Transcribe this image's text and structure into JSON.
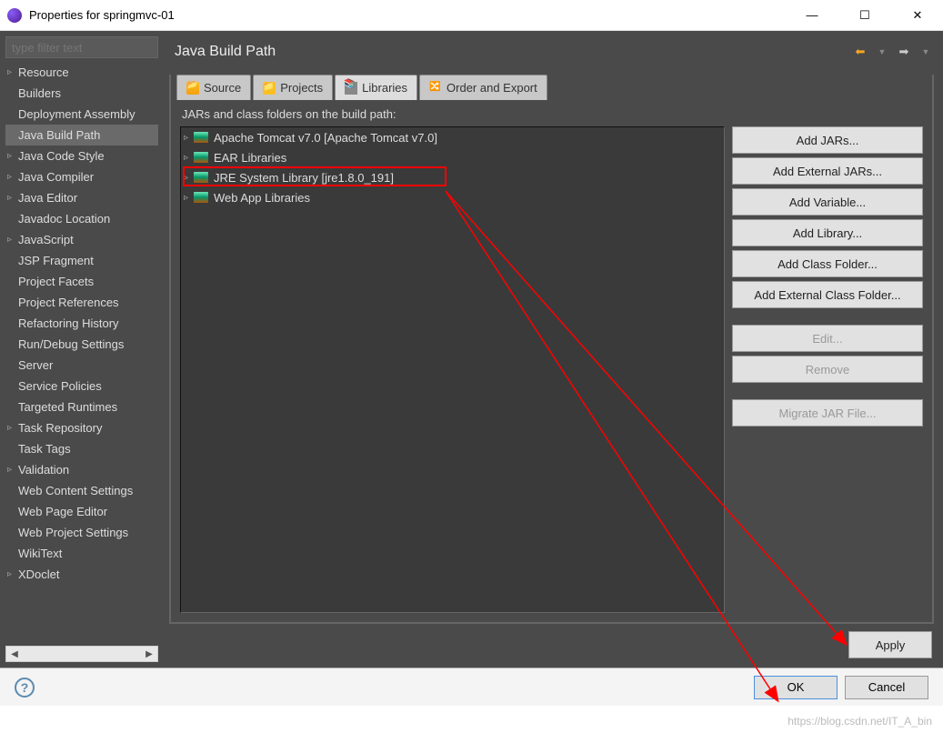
{
  "window": {
    "title": "Properties for springmvc-01",
    "minimize": "—",
    "maximize": "☐",
    "close": "✕"
  },
  "sidebar": {
    "filter_placeholder": "type filter text",
    "items": [
      {
        "label": "Resource",
        "expandable": true
      },
      {
        "label": "Builders",
        "expandable": false
      },
      {
        "label": "Deployment Assembly",
        "expandable": false
      },
      {
        "label": "Java Build Path",
        "expandable": false,
        "selected": true
      },
      {
        "label": "Java Code Style",
        "expandable": true
      },
      {
        "label": "Java Compiler",
        "expandable": true
      },
      {
        "label": "Java Editor",
        "expandable": true
      },
      {
        "label": "Javadoc Location",
        "expandable": false
      },
      {
        "label": "JavaScript",
        "expandable": true
      },
      {
        "label": "JSP Fragment",
        "expandable": false
      },
      {
        "label": "Project Facets",
        "expandable": false
      },
      {
        "label": "Project References",
        "expandable": false
      },
      {
        "label": "Refactoring History",
        "expandable": false
      },
      {
        "label": "Run/Debug Settings",
        "expandable": false
      },
      {
        "label": "Server",
        "expandable": false
      },
      {
        "label": "Service Policies",
        "expandable": false
      },
      {
        "label": "Targeted Runtimes",
        "expandable": false
      },
      {
        "label": "Task Repository",
        "expandable": true
      },
      {
        "label": "Task Tags",
        "expandable": false
      },
      {
        "label": "Validation",
        "expandable": true
      },
      {
        "label": "Web Content Settings",
        "expandable": false
      },
      {
        "label": "Web Page Editor",
        "expandable": false
      },
      {
        "label": "Web Project Settings",
        "expandable": false
      },
      {
        "label": "WikiText",
        "expandable": false
      },
      {
        "label": "XDoclet",
        "expandable": true
      }
    ]
  },
  "main": {
    "title": "Java Build Path",
    "tabs": {
      "source": "Source",
      "projects": "Projects",
      "libraries": "Libraries",
      "order": "Order and Export"
    },
    "panel_label": "JARs and class folders on the build path:",
    "libraries": [
      {
        "label": "Apache Tomcat v7.0 [Apache Tomcat v7.0]"
      },
      {
        "label": "EAR Libraries"
      },
      {
        "label": "JRE System Library [jre1.8.0_191]",
        "highlighted": true
      },
      {
        "label": "Web App Libraries"
      }
    ],
    "buttons": {
      "add_jars": "Add JARs...",
      "add_ext_jars": "Add External JARs...",
      "add_variable": "Add Variable...",
      "add_library": "Add Library...",
      "add_class_folder": "Add Class Folder...",
      "add_ext_class_folder": "Add External Class Folder...",
      "edit": "Edit...",
      "remove": "Remove",
      "migrate": "Migrate JAR File..."
    },
    "apply": "Apply"
  },
  "footer": {
    "ok": "OK",
    "cancel": "Cancel",
    "help": "?"
  },
  "watermark": "https://blog.csdn.net/IT_A_bin"
}
